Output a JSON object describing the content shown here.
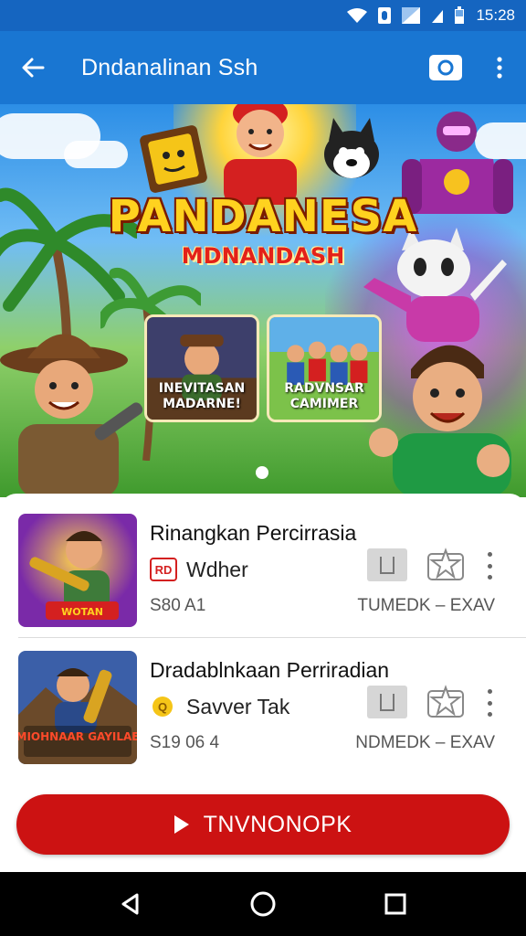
{
  "status_bar": {
    "time": "15:28",
    "icons": [
      "wifi-icon",
      "notification-icon",
      "signal-icon",
      "battery-icon"
    ]
  },
  "app_bar": {
    "title": "Dndanalinan Ssh",
    "back_icon": "arrow-back-icon",
    "camera_icon": "camera-icon",
    "more_icon": "more-vert-icon",
    "color": "#1976d2"
  },
  "banner": {
    "title": "PANDANESA",
    "subtitle": "MDNANDASH",
    "cards": [
      {
        "label": "INEVITASAN MADARNE!"
      },
      {
        "label": "RADVNSAR CAMIMER"
      }
    ],
    "page_indicator": {
      "current": 1,
      "total": 1
    }
  },
  "list": {
    "items": [
      {
        "title": "Rinangkan Percirrasia",
        "publisher": "Wdher",
        "publisher_badge": "RD",
        "meta": "S80 A1",
        "tag": "TUMEDK – EXAV",
        "thumb_text": "WOTAN"
      },
      {
        "title": "Dradablnkaan Perriradian",
        "publisher": "Savver Tak",
        "publisher_badge": "Q",
        "meta": "S19 06 4",
        "tag": "NDMEDK – EXAV",
        "thumb_text": "MIOHNAAR GAYILAE"
      }
    ]
  },
  "cta": {
    "label": "TNVNONOPK",
    "icon": "play-icon",
    "color": "#cc1212"
  },
  "nav_bar": {
    "buttons": [
      "back-triangle-icon",
      "home-circle-icon",
      "recents-square-icon"
    ]
  }
}
